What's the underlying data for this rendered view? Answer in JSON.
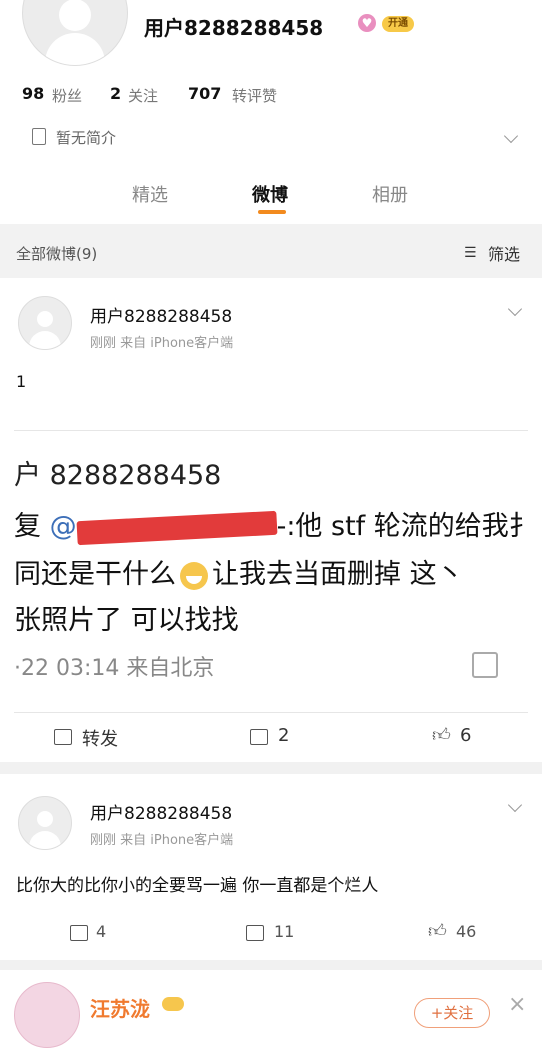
{
  "profile": {
    "username": "用户8288288458",
    "badge": "开通",
    "followers_count": "98",
    "followers_label": "粉丝",
    "following_count": "2",
    "following_label": "关注",
    "likes_count": "707",
    "likes_label": "转评赞",
    "intro": "暂无简介"
  },
  "tabs": [
    {
      "label": "精选"
    },
    {
      "label": "微博"
    },
    {
      "label": "相册"
    }
  ],
  "filter_bar": {
    "title": "全部微博(9)",
    "filter_label": "筛选"
  },
  "post1": {
    "author": "用户8288288458",
    "meta": "刚刚  来自 iPhone客户端",
    "text": "1",
    "repost": {
      "title": "户 8288288458",
      "line1_prefix": "复 ",
      "mention": "@",
      "line1_suffix": "-:他 stf 轮流的给我扌",
      "line2_a": "同还是干什么",
      "line2_b": "让我去当面删掉 这丶",
      "line3": "张照片了 可以找找",
      "time": "·22 03:14  来自北京"
    },
    "actions": {
      "repost": "转发",
      "comments": "2",
      "likes": "6"
    }
  },
  "post2": {
    "author": "用户8288288458",
    "meta": "刚刚  来自 iPhone客户端",
    "text": "比你大的比你小的全要骂一遍 你一直都是个烂人",
    "actions": {
      "reposts": "4",
      "comments": "11",
      "likes": "46"
    }
  },
  "recommend": {
    "name": "汪苏泷",
    "follow_label": "+关注"
  },
  "colors": {
    "accent": "#f28a1e",
    "link": "#3d6fb8"
  }
}
